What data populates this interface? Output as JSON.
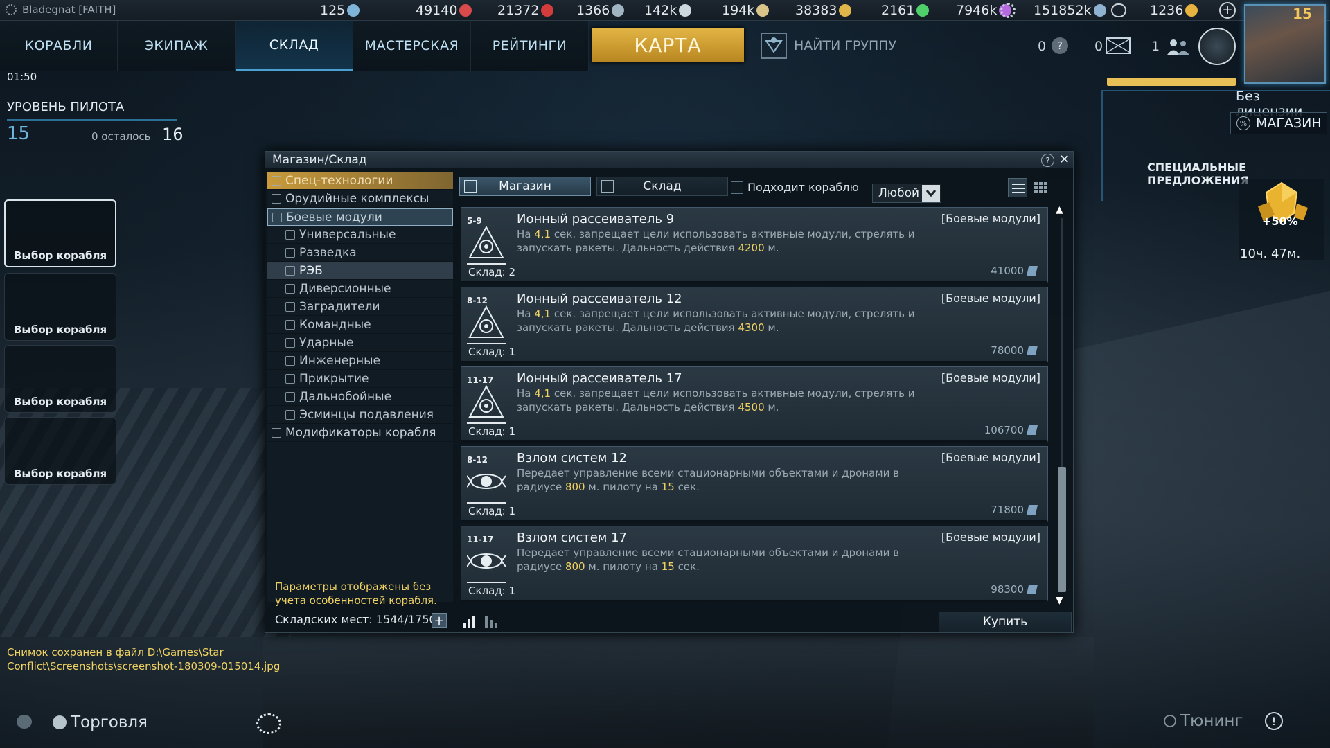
{
  "topbar": {
    "player_name": "Bladegnat [FAITH]",
    "resources": [
      {
        "value": "125",
        "icon": "unit-icon",
        "color": "#7fb4d8"
      },
      {
        "value": "49140",
        "icon": "heart-icon",
        "color": "#d94a4a"
      },
      {
        "value": "21372",
        "icon": "gem-icon",
        "color": "#d43b3b"
      },
      {
        "value": "1366",
        "icon": "coin-icon",
        "color": "#9fb5c2"
      },
      {
        "value": "142k",
        "icon": "moon-icon",
        "color": "#cdd8de"
      },
      {
        "value": "194k",
        "icon": "wings-icon",
        "color": "#d9c48a"
      },
      {
        "value": "38383",
        "icon": "star-badge-icon",
        "color": "#e0b64a"
      },
      {
        "value": "2161",
        "icon": "leaf-icon",
        "color": "#4ecf6a"
      },
      {
        "value": "7946k",
        "icon": "orb-icon",
        "color": "#b66adf"
      },
      {
        "value": "151852k",
        "icon": "credit-icon",
        "color": "#8fb2d0"
      },
      {
        "value": "1236",
        "icon": "gold-icon",
        "color": "#e7b340"
      }
    ]
  },
  "nav": {
    "tabs": [
      {
        "label": "КОРАБЛИ"
      },
      {
        "label": "ЭКИПАЖ"
      },
      {
        "label": "СКЛАД"
      },
      {
        "label": "МАСТЕРСКАЯ"
      },
      {
        "label": "РЕЙТИНГИ"
      }
    ],
    "map_label": "КАРТА",
    "find_group_label": "НАЙТИ ГРУППУ",
    "help_count": "0",
    "mail_count": "0",
    "friends_count": "1"
  },
  "profile": {
    "level": "15",
    "license": "Без лицензии",
    "shop_label": "МАГАЗИН",
    "offers_title": "СПЕЦИАЛЬНЫЕ ПРЕДЛОЖЕНИЯ",
    "offer_percent": "+50%",
    "offer_time": "10ч. 47м."
  },
  "left": {
    "clock": "01:50",
    "pilot_title": "УРОВЕНЬ ПИЛОТА",
    "pilot_current": "15",
    "pilot_remaining": "0 осталось",
    "pilot_next": "16",
    "slot_label": "Выбор корабля",
    "log": "Снимок сохранен в файл D:\\Games\\Star Conflict\\Screenshots\\screenshot-180309-015014.jpg",
    "trade_label": "Торговля",
    "tuning_label": "Тюнинг"
  },
  "dialog": {
    "title": "Магазин/Склад",
    "categories": [
      {
        "label": "Спец-технологии"
      },
      {
        "label": "Орудийные комплексы"
      },
      {
        "label": "Боевые модули"
      },
      {
        "label": "Универсальные"
      },
      {
        "label": "Разведка"
      },
      {
        "label": "РЭБ"
      },
      {
        "label": "Диверсионные"
      },
      {
        "label": "Заградители"
      },
      {
        "label": "Командные"
      },
      {
        "label": "Ударные"
      },
      {
        "label": "Инженерные"
      },
      {
        "label": "Прикрытие"
      },
      {
        "label": "Дальнобойные"
      },
      {
        "label": "Эсминцы подавления"
      },
      {
        "label": "Модификаторы корабля"
      }
    ],
    "note": "Параметры отображены без учета особенностей корабля.",
    "storage_label": "Складских мест: 1544/1750",
    "tab_shop": "Магазин",
    "tab_store": "Склад",
    "fit_label": "Подходит кораблю",
    "filter_value": "Любой",
    "buy_label": "Купить",
    "items": [
      {
        "levels": "5-9",
        "name": "Ионный рассеиватель 9",
        "category": "[Боевые модули]",
        "desc_a": "На ",
        "desc_v1": "4,1",
        "desc_b": " сек. запрещает цели использовать активные модули, стрелять и запускать ракеты. Дальность действия ",
        "desc_v2": "4200",
        "desc_c": " м.",
        "stock": "Склад: 2",
        "price": "41000"
      },
      {
        "levels": "8-12",
        "name": "Ионный рассеиватель 12",
        "category": "[Боевые модули]",
        "desc_a": "На ",
        "desc_v1": "4,1",
        "desc_b": " сек. запрещает цели использовать активные модули, стрелять и запускать ракеты. Дальность действия ",
        "desc_v2": "4300",
        "desc_c": " м.",
        "stock": "Склад: 1",
        "price": "78000"
      },
      {
        "levels": "11-17",
        "name": "Ионный рассеиватель 17",
        "category": "[Боевые модули]",
        "desc_a": "На ",
        "desc_v1": "4,1",
        "desc_b": " сек. запрещает цели использовать активные модули, стрелять и запускать ракеты. Дальность действия ",
        "desc_v2": "4500",
        "desc_c": " м.",
        "stock": "Склад: 1",
        "price": "106700"
      },
      {
        "levels": "8-12",
        "name": "Взлом систем 12",
        "category": "[Боевые модули]",
        "desc_a": "Передает управление всеми стационарными объектами и дронами в радиусе ",
        "desc_v1": "800",
        "desc_b": " м. пилоту на ",
        "desc_v2": "15",
        "desc_c": " сек.",
        "stock": "Склад: 1",
        "price": "71800"
      },
      {
        "levels": "11-17",
        "name": "Взлом систем 17",
        "category": "[Боевые модули]",
        "desc_a": "Передает управление всеми стационарными объектами и дронами в радиусе ",
        "desc_v1": "800",
        "desc_b": " м. пилоту на ",
        "desc_v2": "15",
        "desc_c": " сек.",
        "stock": "Склад: 1",
        "price": "98300"
      }
    ]
  }
}
